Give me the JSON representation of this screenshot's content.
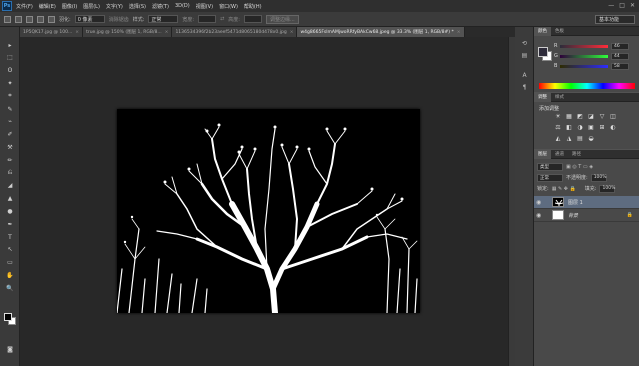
{
  "app": {
    "logo": "Ps"
  },
  "menu": [
    "文件(F)",
    "编辑(E)",
    "图像(I)",
    "图层(L)",
    "文字(Y)",
    "选择(S)",
    "滤镜(T)",
    "3D(D)",
    "视图(V)",
    "窗口(W)",
    "帮助(H)"
  ],
  "window_controls": [
    "—",
    "□",
    "✕"
  ],
  "options": {
    "feather_label": "羽化:",
    "feather_value": "0 像素",
    "antialias": "消除锯齿",
    "style_label": "样式:",
    "style_value": "正常",
    "width_label": "宽度:",
    "height_label": "高度:",
    "refine_edge": "调整边缘...",
    "workspace": "基本功能"
  },
  "doc_tabs": [
    {
      "label": "1P5QK17.jpg @ 100...",
      "active": false
    },
    {
      "label": "true.jpg @ 150% (图层 1, RGB/8...",
      "active": false
    },
    {
      "label": "1136534396f2b23aeef5471d8065180d478x0.jpg",
      "active": false
    },
    {
      "label": "w4g8665FslmAMjwoRRfyBAkCw68.jpeg @ 33.3% (图层 1, RGB/8#) *",
      "active": true
    }
  ],
  "color_panel": {
    "tabs": [
      "颜色",
      "色板"
    ],
    "channels": [
      {
        "name": "R",
        "value": "46",
        "color": "#e03030"
      },
      {
        "name": "G",
        "value": "44",
        "color": "#30c030"
      },
      {
        "name": "B",
        "value": "58",
        "color": "#3050e0"
      }
    ],
    "foreground": "#2e2c3a",
    "background": "#ffffff"
  },
  "adjust_panel": {
    "tabs": [
      "调整",
      "样式"
    ],
    "heading": "添加调整",
    "icons": [
      "☀",
      "▦",
      "◩",
      "◪",
      "▽",
      "◫",
      "⚖",
      "◧",
      "◑",
      "▣",
      "⊞",
      "◐",
      "◭",
      "◮",
      "▤",
      "◒"
    ]
  },
  "layers_panel": {
    "tabs": [
      "图层",
      "通道",
      "路径"
    ],
    "kind": "类型",
    "blend_mode": "正常",
    "opacity_label": "不透明度:",
    "opacity": "100%",
    "lock_label": "锁定:",
    "fill_label": "填充:",
    "fill": "100%",
    "layers": [
      {
        "name": "图层 1",
        "selected": true,
        "thumb": "tree"
      },
      {
        "name": "背景",
        "selected": false,
        "thumb": "white"
      }
    ]
  },
  "tools": [
    "▸",
    "⬚",
    "ʘ",
    "✦",
    "⌗",
    "✎",
    "⌁",
    "✐",
    "⚒",
    "✏",
    "⎌",
    "◢",
    "▲",
    "●",
    "✒",
    "T",
    "↖",
    "▭",
    "✋",
    "🔍"
  ]
}
